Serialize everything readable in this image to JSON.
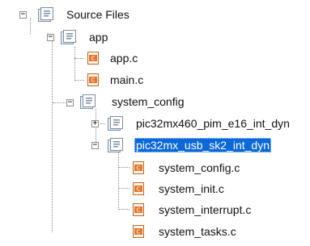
{
  "tree": {
    "nodes": [
      {
        "label": "Source Files",
        "type": "folder",
        "state": "expanded",
        "selected": false,
        "icon": "folder-icon"
      },
      {
        "label": "app",
        "type": "folder",
        "state": "expanded",
        "selected": false,
        "icon": "folder-icon"
      },
      {
        "label": "app.c",
        "type": "file",
        "state": null,
        "selected": false,
        "icon": "c-file-icon"
      },
      {
        "label": "main.c",
        "type": "file",
        "state": null,
        "selected": false,
        "icon": "c-file-icon"
      },
      {
        "label": "system_config",
        "type": "folder",
        "state": "expanded",
        "selected": false,
        "icon": "folder-icon"
      },
      {
        "label": "pic32mx460_pim_e16_int_dyn",
        "type": "folder",
        "state": "collapsed",
        "selected": false,
        "icon": "folder-icon"
      },
      {
        "label": "pic32mx_usb_sk2_int_dyn",
        "type": "folder",
        "state": "expanded",
        "selected": true,
        "icon": "folder-icon"
      },
      {
        "label": "system_config.c",
        "type": "file",
        "state": null,
        "selected": false,
        "icon": "c-file-icon"
      },
      {
        "label": "system_init.c",
        "type": "file",
        "state": null,
        "selected": false,
        "icon": "c-file-icon"
      },
      {
        "label": "system_interrupt.c",
        "type": "file",
        "state": null,
        "selected": false,
        "icon": "c-file-icon"
      },
      {
        "label": "system_tasks.c",
        "type": "file",
        "state": null,
        "selected": false,
        "icon": "c-file-icon"
      }
    ],
    "colors": {
      "selection": "#0a68d8",
      "folder": "#7e8da3",
      "file_accent": "#e2772d"
    }
  }
}
